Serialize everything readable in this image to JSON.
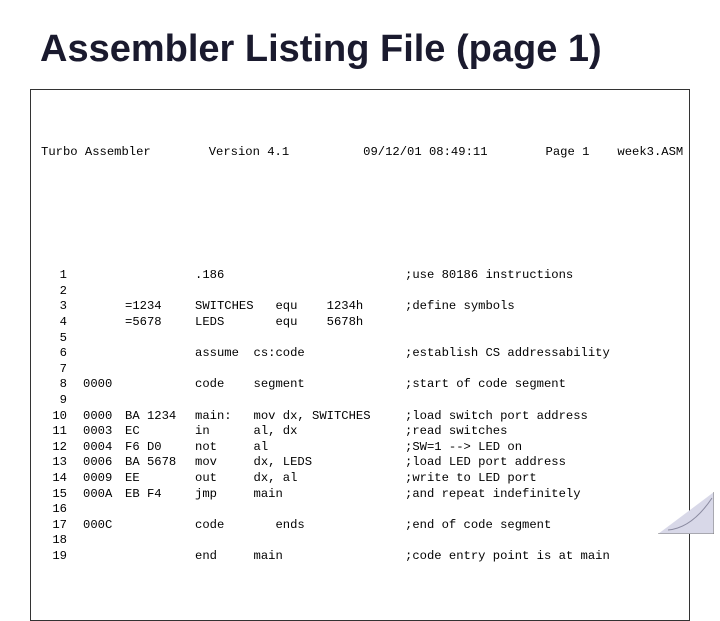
{
  "title": "Assembler Listing File (page 1)",
  "header": {
    "left": "Turbo Assembler",
    "version": "Version 4.1",
    "datetime": "09/12/01 08:49:11",
    "page": "Page 1",
    "filename": "week3.ASM"
  },
  "lines": [
    {
      "ln": "1",
      "addr": "",
      "hex": "",
      "src": ".186",
      "cmt": ";use 80186 instructions"
    },
    {
      "ln": "2",
      "addr": "",
      "hex": "",
      "src": "",
      "cmt": ""
    },
    {
      "ln": "3",
      "addr": "",
      "hex": "=1234",
      "src": "SWITCHES   equ    1234h",
      "cmt": ";define symbols"
    },
    {
      "ln": "4",
      "addr": "",
      "hex": "=5678",
      "src": "LEDS       equ    5678h",
      "cmt": ""
    },
    {
      "ln": "5",
      "addr": "",
      "hex": "",
      "src": "",
      "cmt": ""
    },
    {
      "ln": "6",
      "addr": "",
      "hex": "",
      "src": "assume  cs:code",
      "cmt": ";establish CS addressability"
    },
    {
      "ln": "7",
      "addr": "",
      "hex": "",
      "src": "",
      "cmt": ""
    },
    {
      "ln": "8",
      "addr": "0000",
      "hex": "",
      "src": "code    segment",
      "cmt": ";start of code segment"
    },
    {
      "ln": "9",
      "addr": "",
      "hex": "",
      "src": "",
      "cmt": ""
    },
    {
      "ln": "10",
      "addr": "0000",
      "hex": "BA 1234",
      "src": "main:   mov dx, SWITCHES",
      "cmt": ";load switch port address"
    },
    {
      "ln": "11",
      "addr": "0003",
      "hex": "EC",
      "src": "in      al, dx",
      "cmt": ";read switches"
    },
    {
      "ln": "12",
      "addr": "0004",
      "hex": "F6 D0",
      "src": "not     al",
      "cmt": ";SW=1 --> LED on"
    },
    {
      "ln": "13",
      "addr": "0006",
      "hex": "BA 5678",
      "src": "mov     dx, LEDS",
      "cmt": ";load LED port address"
    },
    {
      "ln": "14",
      "addr": "0009",
      "hex": "EE",
      "src": "out     dx, al",
      "cmt": ";write to LED port"
    },
    {
      "ln": "15",
      "addr": "000A",
      "hex": "EB F4",
      "src": "jmp     main",
      "cmt": ";and repeat indefinitely"
    },
    {
      "ln": "16",
      "addr": "",
      "hex": "",
      "src": "",
      "cmt": ""
    },
    {
      "ln": "17",
      "addr": "000C",
      "hex": "",
      "src": "code       ends",
      "cmt": ";end of code segment"
    },
    {
      "ln": "18",
      "addr": "",
      "hex": "",
      "src": "",
      "cmt": ""
    },
    {
      "ln": "19",
      "addr": "",
      "hex": "",
      "src": "end     main",
      "cmt": ";code entry point is at main"
    }
  ]
}
